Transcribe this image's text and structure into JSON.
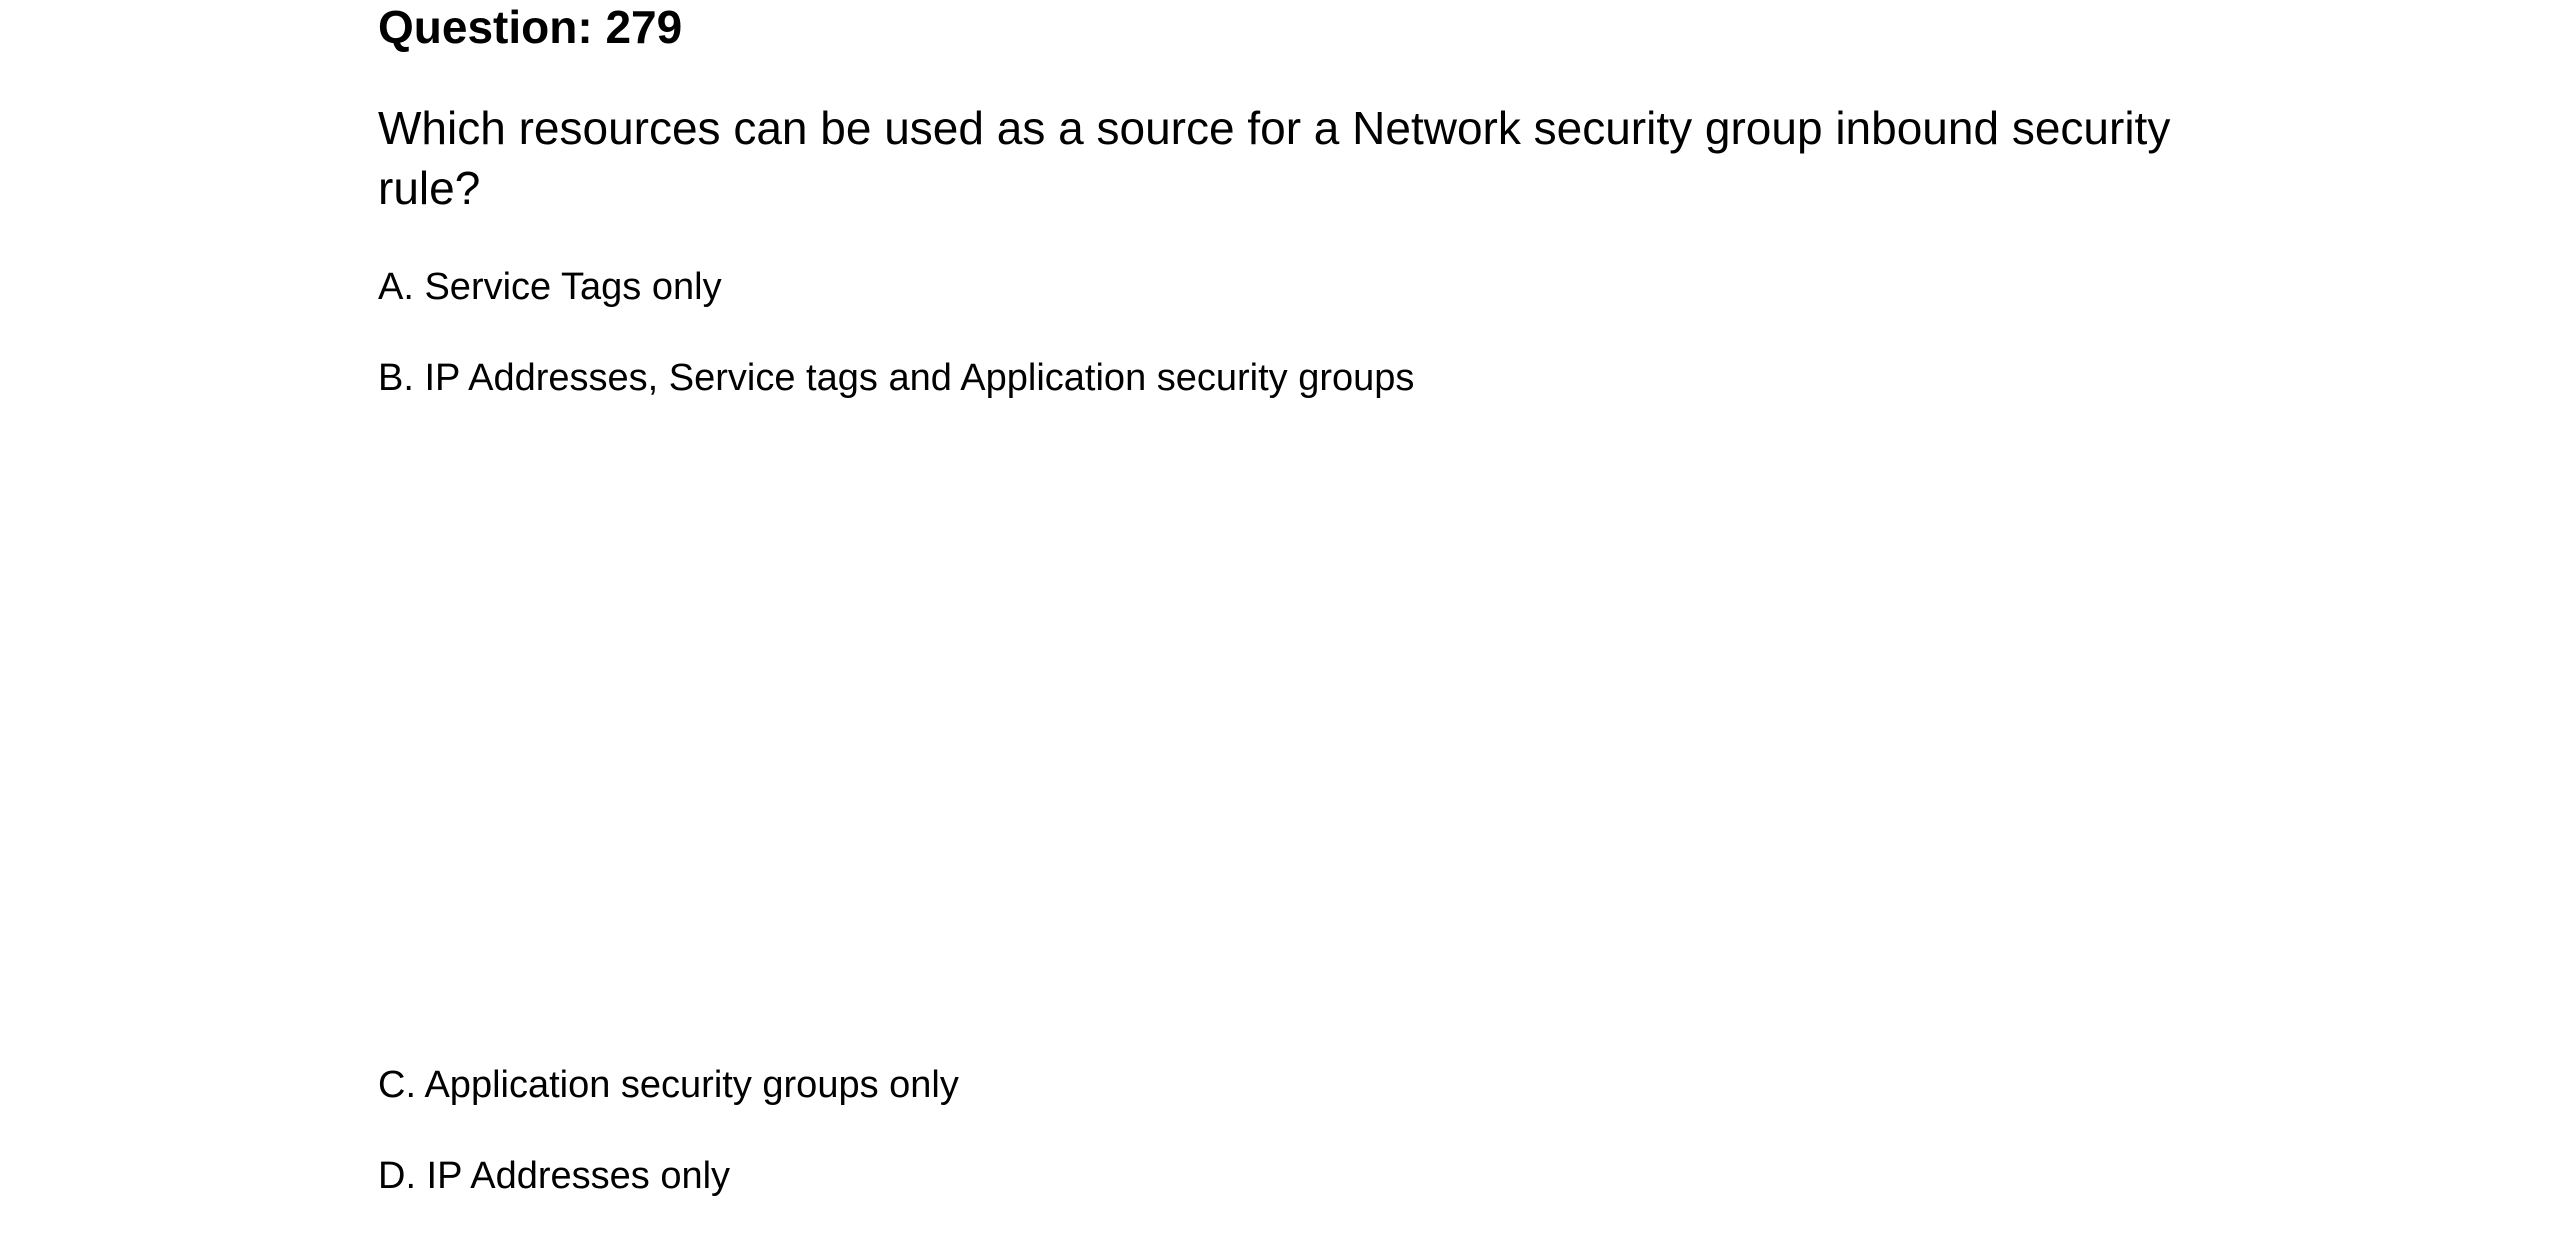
{
  "question": {
    "number_label": "Question: 279",
    "text": "Which resources can be used as a source for a Network security group inbound security rule?"
  },
  "options": [
    {
      "label": "A. Service Tags only"
    },
    {
      "label": "B. IP Addresses, Service tags and Application security groups"
    },
    {
      "label": "C. Application security groups only"
    },
    {
      "label": "D. IP Addresses only"
    }
  ]
}
